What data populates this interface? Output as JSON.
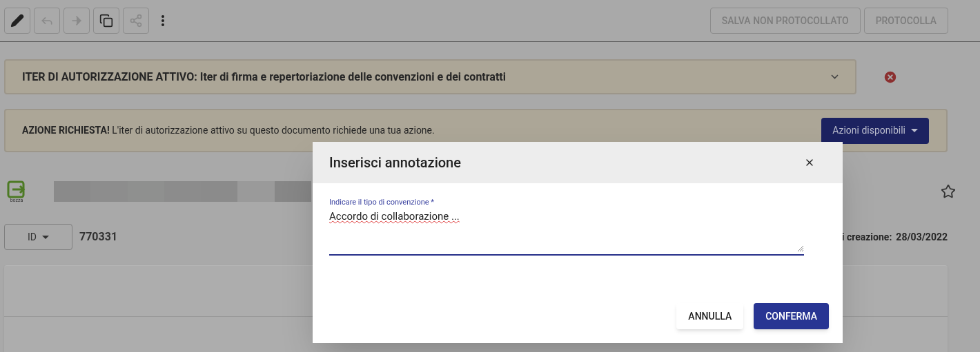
{
  "toolbar": {
    "tools": [
      {
        "kind": "edit",
        "disabled": false
      },
      {
        "kind": "reply",
        "disabled": true
      },
      {
        "kind": "forward",
        "disabled": true
      },
      {
        "kind": "copy",
        "disabled": false
      },
      {
        "kind": "share",
        "disabled": true
      },
      {
        "kind": "more",
        "disabled": false
      }
    ],
    "buttons": [
      {
        "label": "SALVA NON PROTOCOLLATO",
        "disabled": true
      },
      {
        "label": "PROTOCOLLA",
        "disabled": true
      }
    ]
  },
  "iter_banner": {
    "title": "ITER DI AUTORIZZAZIONE ATTIVO: Iter di firma e repertoriazione delle convenzioni e dei contratti",
    "expanded": false
  },
  "action_banner": {
    "text": "**AZIONE RICHIESTA!** L'iter di autorizzazione attivo su questo documento richiede una tua azione.",
    "button": "Azioni disponibili"
  },
  "document": {
    "status": "bozza",
    "starred": false,
    "id_selector": "ID",
    "id": "770331",
    "date_label": "i creazione:",
    "date": "28/03/2022"
  },
  "dialog": {
    "title": "Inserisci annotazione",
    "field": {
      "label": "Indicare il tipo di convenzione *",
      "value": "Accordo di collaborazione ..."
    },
    "buttons": [
      {
        "label": "ANNULLA",
        "kind": "secondary"
      },
      {
        "label": "CONFERMA",
        "kind": "primary"
      }
    ]
  }
}
